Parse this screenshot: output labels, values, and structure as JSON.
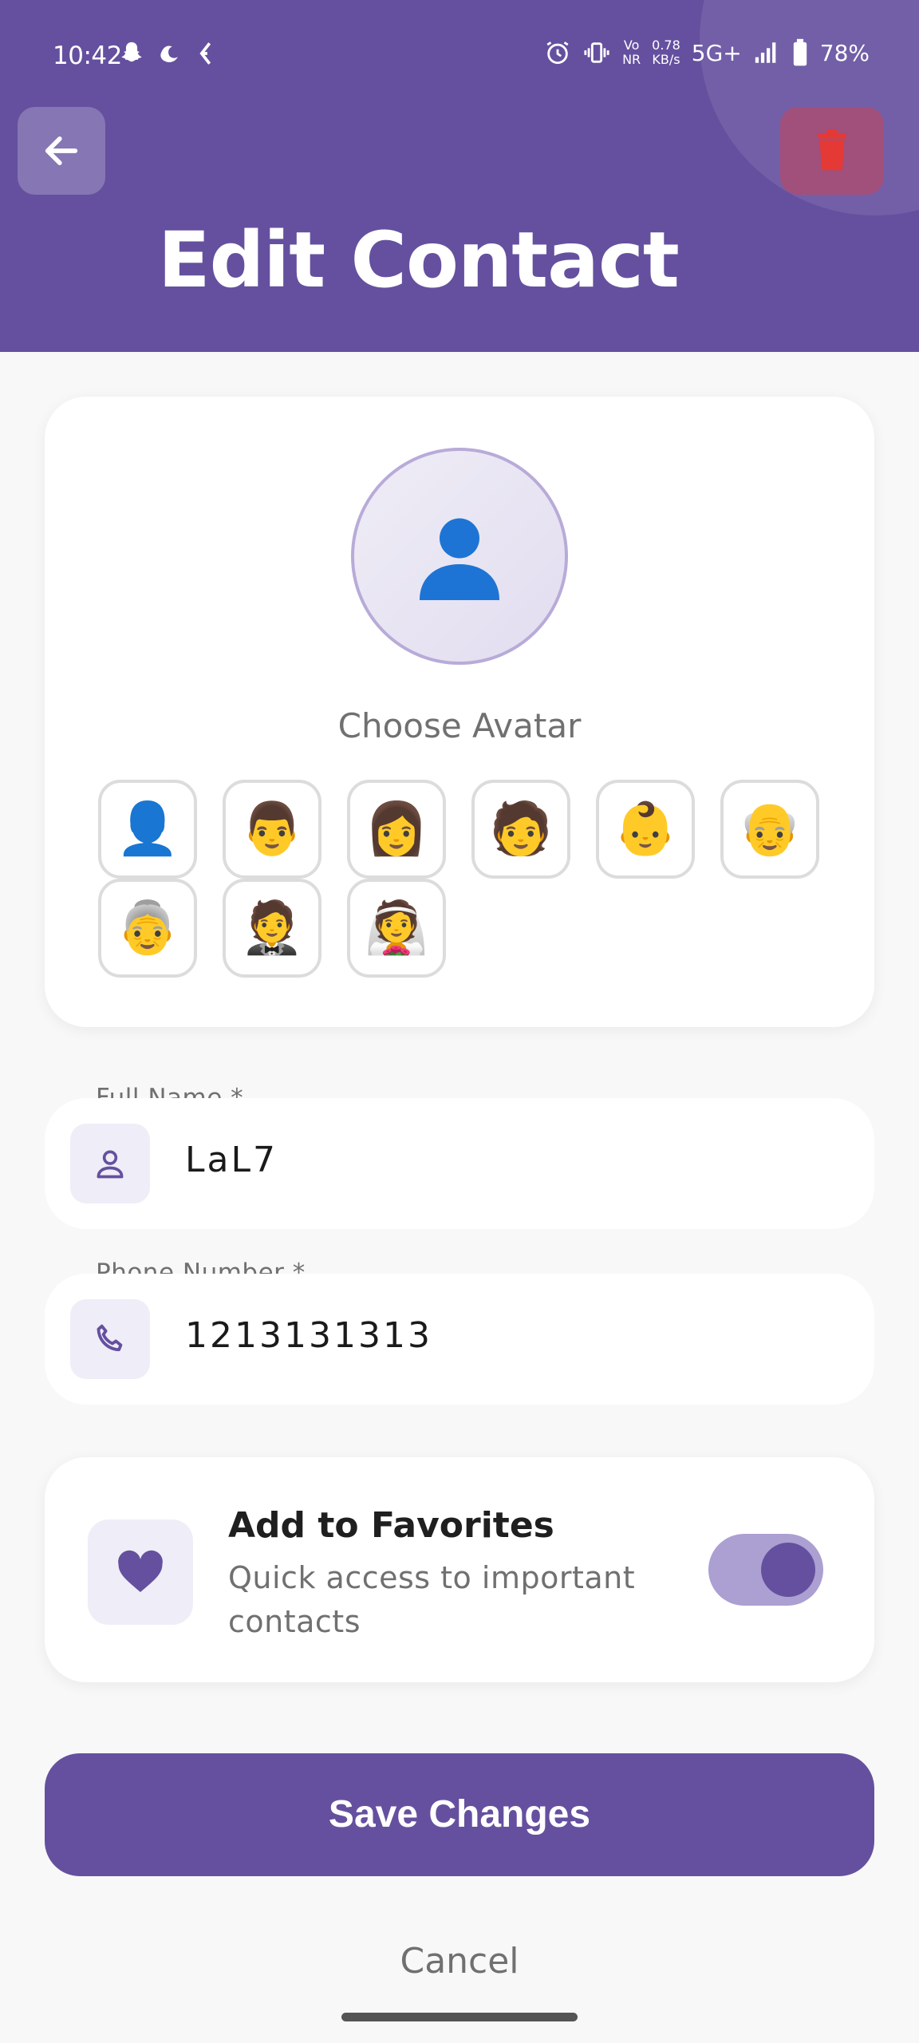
{
  "status_bar": {
    "time": "10:42",
    "notification_icons": [
      "snapchat-icon",
      "app-icon",
      "messenger-icon"
    ],
    "network_speed_value": "0.78",
    "network_speed_unit": "KB/s",
    "network_type": "5G+",
    "vo_nr_label_top": "Vo",
    "vo_nr_label_bottom": "NR",
    "battery": "78%"
  },
  "header": {
    "title": "Edit Contact",
    "back_icon": "arrow-left-icon",
    "delete_icon": "trash-icon"
  },
  "avatar": {
    "selected": "👤",
    "label": "Choose Avatar",
    "options": [
      "👤",
      "👨",
      "👩",
      "🧑",
      "👶",
      "👴",
      "👵",
      "🤵",
      "👰"
    ]
  },
  "fields": {
    "full_name": {
      "label": "Full Name *",
      "value": "LaL7",
      "icon": "person-icon"
    },
    "phone": {
      "label": "Phone Number *",
      "value": "1213131313",
      "icon": "phone-icon"
    }
  },
  "favorites": {
    "title": "Add to Favorites",
    "subtitle": "Quick access to important contacts",
    "enabled": true,
    "icon": "heart-icon"
  },
  "actions": {
    "save": "Save Changes",
    "cancel": "Cancel"
  },
  "colors": {
    "primary": "#65509f",
    "danger": "#e53935",
    "toggle_track": "#ac9fd2"
  }
}
